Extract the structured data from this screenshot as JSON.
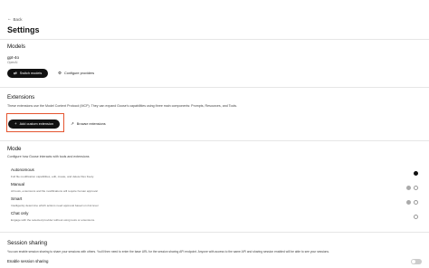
{
  "nav": {
    "back_label": "Back"
  },
  "page": {
    "title": "Settings"
  },
  "models": {
    "heading": "Models",
    "current_model": "gpt-4o",
    "current_provider": "OpenAI",
    "switch_label": "Switch models",
    "configure_label": "Configure providers"
  },
  "extensions": {
    "heading": "Extensions",
    "description": "These extensions use the Model Context Protocol (MCP). They can expand Goose's capabilities using three main components: Prompts, Resources, and Tools.",
    "add_label": "Add custom extension",
    "browse_label": "Browse extensions",
    "highlight_color": "#e55530"
  },
  "mode": {
    "heading": "Mode",
    "description": "Configure how Goose interacts with tools and extensions",
    "options": [
      {
        "label": "Autonomous",
        "desc": "Full file modification capabilities, edit, create, and delete files freely.",
        "selected": true
      },
      {
        "label": "Manual",
        "desc": "All tools, extensions and file modifications will require human approval",
        "selected": false
      },
      {
        "label": "Smart",
        "desc": "Intelligently determine which actions need approval based on risk level",
        "selected": false
      },
      {
        "label": "Chat only",
        "desc": "Engage with the selected provider without using tools or extensions.",
        "selected": false
      }
    ]
  },
  "session_sharing": {
    "heading": "Session sharing",
    "description": "You can enable session sharing to share your sessions with others. You'll then need to enter the base URL for the session sharing API endpoint. Anyone with access to the same API and sharing session enabled will be able to see your sessions.",
    "enable_label": "Enable session sharing"
  }
}
